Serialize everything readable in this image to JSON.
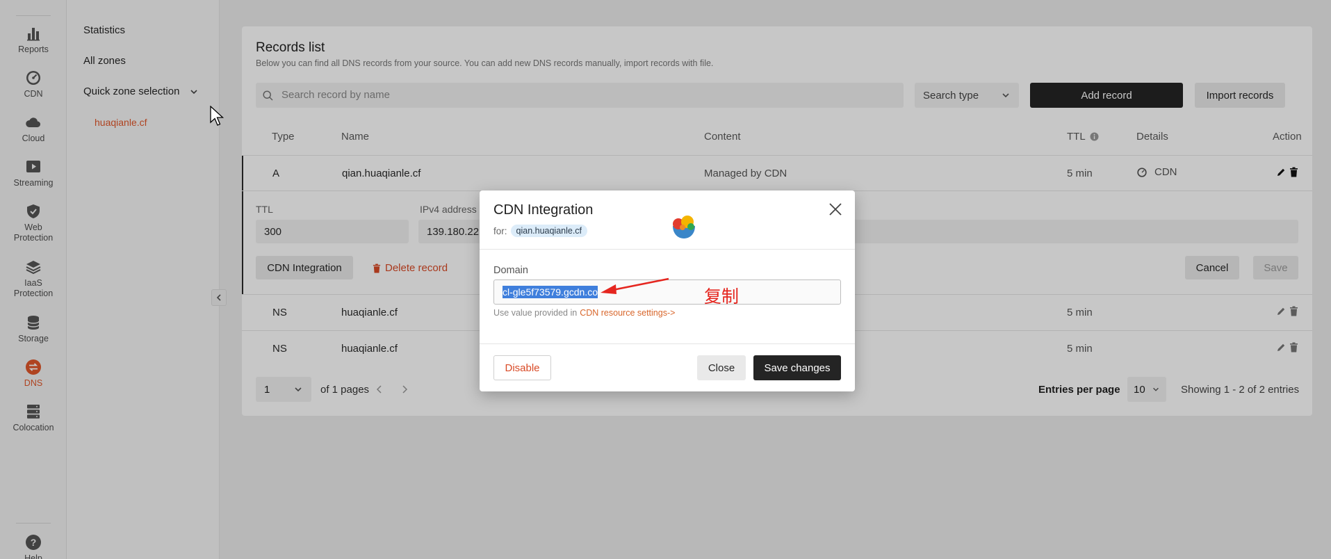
{
  "rail": {
    "items": [
      {
        "label": "Reports",
        "icon": "bar-chart-icon"
      },
      {
        "label": "CDN",
        "icon": "speedometer-icon"
      },
      {
        "label": "Cloud",
        "icon": "cloud-icon"
      },
      {
        "label": "Streaming",
        "icon": "play-icon"
      },
      {
        "label": "Web Protection",
        "icon": "shield-icon"
      },
      {
        "label": "IaaS Protection",
        "icon": "layers-icon"
      },
      {
        "label": "Storage",
        "icon": "database-icon"
      },
      {
        "label": "DNS",
        "icon": "dns-icon"
      },
      {
        "label": "Colocation",
        "icon": "server-icon"
      }
    ],
    "help_label": "Help",
    "accent": "#e0562a"
  },
  "submenu": {
    "statistics": "Statistics",
    "all_zones": "All zones",
    "quick_zone": "Quick zone selection",
    "zone": "huaqianle.cf"
  },
  "records": {
    "title": "Records list",
    "subtitle": "Below you can find all DNS records from your source. You can add new DNS records manually, import records with file.",
    "search_placeholder": "Search record by name",
    "search_type": "Search type",
    "add_record": "Add record",
    "import_records": "Import records",
    "columns": {
      "type": "Type",
      "name": "Name",
      "content": "Content",
      "ttl": "TTL",
      "details": "Details",
      "action": "Action"
    },
    "rows": [
      {
        "type": "A",
        "name": "qian.huaqianle.cf",
        "content": "Managed by CDN",
        "ttl": "5 min",
        "details": "CDN"
      },
      {
        "type": "NS",
        "name": "huaqianle.cf",
        "content": "",
        "ttl": "5 min",
        "details": ""
      },
      {
        "type": "NS",
        "name": "huaqianle.cf",
        "content": "",
        "ttl": "5 min",
        "details": ""
      }
    ],
    "edit": {
      "ttl_label": "TTL",
      "ttl_value": "300",
      "ipv4_label": "IPv4 address",
      "ipv4_value": "139.180.22",
      "cdn_integration": "CDN Integration",
      "delete_record": "Delete record",
      "cancel": "Cancel",
      "save": "Save"
    },
    "pagination": {
      "page": "1",
      "of_pages": "of 1 pages",
      "entries_label": "Entries per page",
      "entries_value": "10",
      "showing": "Showing 1 - 2 of 2 entries"
    }
  },
  "modal": {
    "title": "CDN Integration",
    "for_label": "for:",
    "for_value": "qian.huaqianle.cf",
    "domain_label": "Domain",
    "domain_value": "cl-gle5f73579.gcdn.co",
    "hint_prefix": "Use value provided in",
    "hint_link": "CDN resource settings->",
    "annotation": "复制",
    "disable": "Disable",
    "close": "Close",
    "save_changes": "Save changes"
  }
}
